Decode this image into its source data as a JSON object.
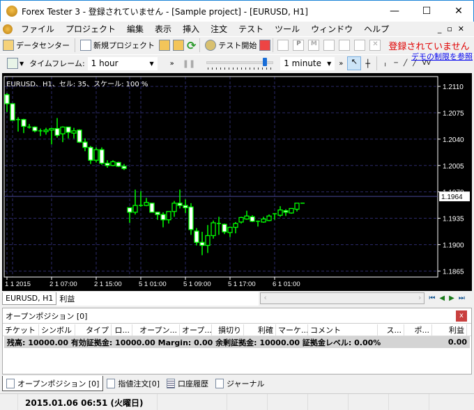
{
  "window": {
    "title": "Forex Tester 3 - 登録されていません - [Sample project] - [EURUSD, H1]",
    "logo": "S",
    "minimize": "—",
    "maximize": "☐",
    "close": "✕"
  },
  "menu": [
    "ファイル",
    "プロジェクト",
    "編集",
    "表示",
    "挿入",
    "注文",
    "テスト",
    "ツール",
    "ウィンドウ",
    "ヘルプ"
  ],
  "toolbar1": {
    "data_center": "データセンター",
    "new_project": "新規プロジェクト",
    "test_start": "テスト開始",
    "unregistered": "登録されていません",
    "demo_limit_link": "デモの制限を参照"
  },
  "toolbar2": {
    "timeframe_label": "タイムフレーム:",
    "timeframe_value": "1 hour",
    "speed_value": "1 minute",
    "speed_slider": 0.9
  },
  "colors": {
    "bull": "#00ff00",
    "bear_fill": "#ffffff",
    "grid": "#2c2a6a",
    "price_line": "#4a4a9a",
    "unregistered": "#e00000",
    "link": "#0000ee"
  },
  "chart": {
    "info": "EURUSD、H1、セル: 35、スケール: 100 %",
    "current_price": "1.1964"
  },
  "chart_data": {
    "type": "candlestick",
    "symbol": "EURUSD",
    "timeframe": "H1",
    "ylim": [
      1.1857,
      1.2123
    ],
    "y_ticks": [
      "1.2110",
      "1.2075",
      "1.2040",
      "1.2005",
      "1.1970",
      "1.1935",
      "1.1900",
      "1.1865"
    ],
    "x_labels": [
      {
        "i": 0,
        "label": "1 1 2015"
      },
      {
        "i": 8,
        "label": "2 1 07:00"
      },
      {
        "i": 16,
        "label": "2 1 15:00"
      },
      {
        "i": 24,
        "label": "5 1 01:00"
      },
      {
        "i": 32,
        "label": "5 1 09:00"
      },
      {
        "i": 40,
        "label": "5 1 17:00"
      },
      {
        "i": 48,
        "label": "6 1 01:00"
      }
    ],
    "current_price": 1.1964,
    "ohlc": [
      [
        1.2099,
        1.2101,
        1.2076,
        1.2087
      ],
      [
        1.2087,
        1.2087,
        1.2065,
        1.2065
      ],
      [
        1.2066,
        1.2069,
        1.205,
        1.2066
      ],
      [
        1.2066,
        1.2067,
        1.2048,
        1.2057
      ],
      [
        1.2056,
        1.206,
        1.2054,
        1.2056
      ],
      [
        1.2056,
        1.2057,
        1.2049,
        1.2051
      ],
      [
        1.2051,
        1.2054,
        1.2044,
        1.205
      ],
      [
        1.205,
        1.2055,
        1.2046,
        1.2052
      ],
      [
        1.2052,
        1.2055,
        1.2033,
        1.2054
      ],
      [
        1.2054,
        1.2068,
        1.2042,
        1.2045
      ],
      [
        1.2047,
        1.2057,
        1.2036,
        1.2056
      ],
      [
        1.2056,
        1.2056,
        1.2041,
        1.2049
      ],
      [
        1.2048,
        1.2055,
        1.2041,
        1.2051
      ],
      [
        1.2052,
        1.2053,
        1.2035,
        1.2036
      ],
      [
        1.2036,
        1.2041,
        1.2024,
        1.2029
      ],
      [
        1.2029,
        1.2031,
        1.2007,
        1.2012
      ],
      [
        1.2012,
        1.2029,
        1.2009,
        1.2026
      ],
      [
        1.2026,
        1.2029,
        1.2006,
        1.2008
      ],
      [
        1.2008,
        1.2012,
        1.2002,
        1.2005
      ],
      [
        1.2005,
        1.2012,
        1.2004,
        1.201
      ],
      [
        1.2009,
        1.201,
        1.2003,
        1.2004
      ],
      [
        1.2004,
        1.2007,
        1.1999,
        1.2001
      ],
      [
        1.1949,
        1.1949,
        1.1929,
        1.1943
      ],
      [
        1.1943,
        1.1973,
        1.194,
        1.1952
      ],
      [
        1.1952,
        1.1971,
        1.195,
        1.1952
      ],
      [
        1.1952,
        1.1962,
        1.1951,
        1.1956
      ],
      [
        1.1955,
        1.1955,
        1.1943,
        1.1943
      ],
      [
        1.1943,
        1.1943,
        1.1933,
        1.194
      ],
      [
        1.194,
        1.1943,
        1.1923,
        1.1933
      ],
      [
        1.1933,
        1.1944,
        1.1928,
        1.1944
      ],
      [
        1.1944,
        1.1958,
        1.1937,
        1.1955
      ],
      [
        1.1955,
        1.1973,
        1.1948,
        1.1952
      ],
      [
        1.1952,
        1.196,
        1.1942,
        1.1949
      ],
      [
        1.195,
        1.1955,
        1.1913,
        1.192
      ],
      [
        1.1918,
        1.1922,
        1.1899,
        1.1903
      ],
      [
        1.1903,
        1.1917,
        1.1886,
        1.1899
      ],
      [
        1.1899,
        1.1926,
        1.1889,
        1.1912
      ],
      [
        1.1912,
        1.1932,
        1.1908,
        1.1929
      ],
      [
        1.1928,
        1.1937,
        1.1913,
        1.1928
      ],
      [
        1.1927,
        1.1928,
        1.1914,
        1.1917
      ],
      [
        1.1916,
        1.1924,
        1.191,
        1.1923
      ],
      [
        1.1923,
        1.193,
        1.1915,
        1.1928
      ],
      [
        1.193,
        1.1937,
        1.1928,
        1.1936
      ],
      [
        1.1934,
        1.1945,
        1.1933,
        1.1938
      ],
      [
        1.1937,
        1.1939,
        1.193,
        1.1931
      ],
      [
        1.1931,
        1.1932,
        1.1924,
        1.1931
      ],
      [
        1.193,
        1.1937,
        1.1929,
        1.1934
      ],
      [
        1.1932,
        1.194,
        1.1931,
        1.1938
      ],
      [
        1.194,
        1.1941,
        1.1933,
        1.1941
      ],
      [
        1.1939,
        1.1951,
        1.1937,
        1.1946
      ],
      [
        1.1945,
        1.1947,
        1.1938,
        1.1943
      ],
      [
        1.1942,
        1.1948,
        1.1941,
        1.1948
      ],
      [
        1.1947,
        1.1955,
        1.1944,
        1.1955
      ],
      [
        1.1955,
        1.1955,
        1.1955,
        1.1955
      ]
    ]
  },
  "chart_tabs": [
    "EURUSD, H1",
    "利益"
  ],
  "panel": {
    "title": "オープンポジション [0]",
    "close": "x",
    "columns": [
      "チケット",
      "シンボル",
      "タイプ",
      "ロ...",
      "オープン...",
      "オープ...",
      "損切り",
      "利確",
      "マーケ...",
      "コメント",
      "ス...",
      "ポ...",
      "利益"
    ],
    "summary": "残高: 10000.00 有効証拠金: 10000.00 Margin: 0.00 余剰証拠金: 10000.00 証拠金レベル: 0.00%",
    "summary_profit": "0.00"
  },
  "bottom_tabs": [
    "オープンポジション [0]",
    "指値注文[0]",
    "口座履歴",
    "ジャーナル"
  ],
  "status": {
    "datetime": "2015.01.06 06:51 (火曜日)"
  }
}
